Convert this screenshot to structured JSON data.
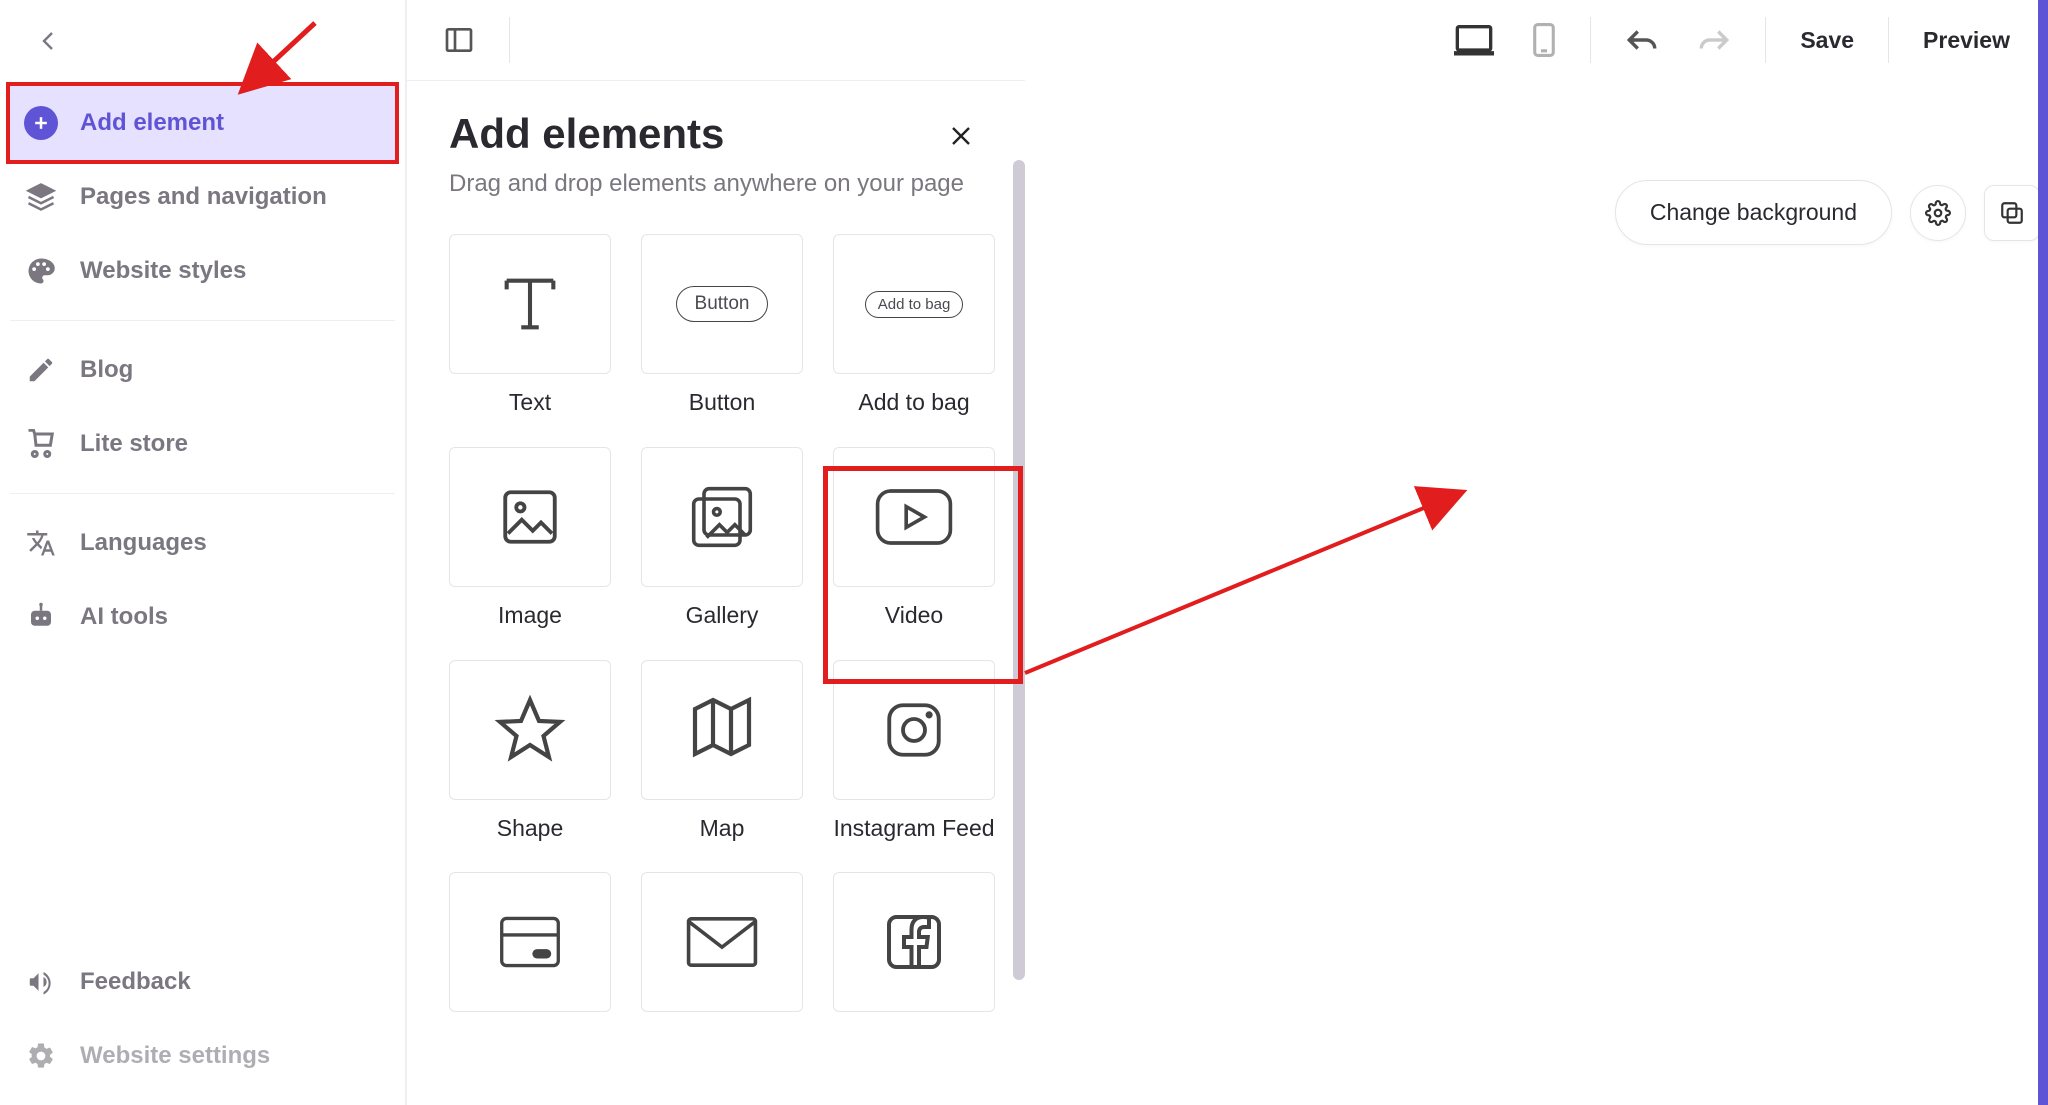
{
  "sidebar": {
    "items": [
      {
        "label": "Add element",
        "icon": "plus-circle"
      },
      {
        "label": "Pages and navigation",
        "icon": "layers"
      },
      {
        "label": "Website styles",
        "icon": "palette"
      },
      {
        "label": "Blog",
        "icon": "edit"
      },
      {
        "label": "Lite store",
        "icon": "cart"
      }
    ],
    "secondary": [
      {
        "label": "Languages",
        "icon": "translate"
      },
      {
        "label": "AI tools",
        "icon": "robot"
      }
    ],
    "footer": [
      {
        "label": "Feedback",
        "icon": "megaphone"
      },
      {
        "label": "Website settings",
        "icon": "gear"
      }
    ]
  },
  "toolbar": {
    "save": "Save",
    "preview": "Preview"
  },
  "panel": {
    "title": "Add elements",
    "subtitle": "Drag and drop elements anywhere on your page",
    "button_text": "Button",
    "addtobag_text": "Add to bag",
    "items": [
      {
        "label": "Text"
      },
      {
        "label": "Button"
      },
      {
        "label": "Add to bag"
      },
      {
        "label": "Image"
      },
      {
        "label": "Gallery"
      },
      {
        "label": "Video"
      },
      {
        "label": "Shape"
      },
      {
        "label": "Map"
      },
      {
        "label": "Instagram Feed"
      },
      {
        "label": ""
      },
      {
        "label": ""
      },
      {
        "label": ""
      }
    ]
  },
  "canvas": {
    "change_bg": "Change background"
  }
}
